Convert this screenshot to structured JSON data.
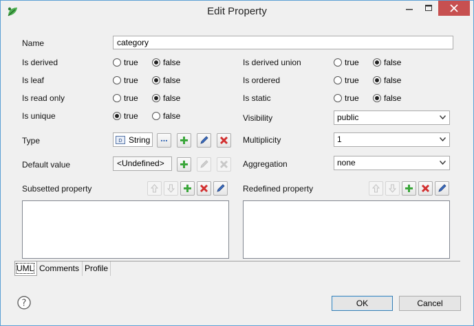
{
  "window": {
    "title": "Edit Property"
  },
  "colors": {
    "close_button": "#c75050",
    "add": "#3aa63a",
    "delete": "#d22f2f",
    "edit": "#3b6ec4"
  },
  "form": {
    "name": {
      "label": "Name",
      "value": "category"
    },
    "is_derived": {
      "label": "Is derived",
      "true_label": "true",
      "false_label": "false",
      "selected": "false"
    },
    "is_leaf": {
      "label": "Is leaf",
      "true_label": "true",
      "false_label": "false",
      "selected": "false"
    },
    "is_read_only": {
      "label": "Is read only",
      "true_label": "true",
      "false_label": "false",
      "selected": "false"
    },
    "is_unique": {
      "label": "Is unique",
      "true_label": "true",
      "false_label": "false",
      "selected": "true"
    },
    "is_derived_union": {
      "label": "Is derived union",
      "true_label": "true",
      "false_label": "false",
      "selected": "false"
    },
    "is_ordered": {
      "label": "Is ordered",
      "true_label": "true",
      "false_label": "false",
      "selected": "false"
    },
    "is_static": {
      "label": "Is static",
      "true_label": "true",
      "false_label": "false",
      "selected": "false"
    },
    "visibility": {
      "label": "Visibility",
      "value": "public"
    },
    "type": {
      "label": "Type",
      "value": "String",
      "browse_label": "…"
    },
    "multiplicity": {
      "label": "Multiplicity",
      "value": "1"
    },
    "default_value": {
      "label": "Default value",
      "value": "<Undefined>"
    },
    "aggregation": {
      "label": "Aggregation",
      "value": "none"
    },
    "subsetted_property": {
      "label": "Subsetted property"
    },
    "redefined_property": {
      "label": "Redefined property"
    }
  },
  "tabs": [
    {
      "label": "UML",
      "active": true
    },
    {
      "label": "Comments",
      "active": false
    },
    {
      "label": "Profile",
      "active": false
    }
  ],
  "footer": {
    "ok_label": "OK",
    "cancel_label": "Cancel"
  }
}
